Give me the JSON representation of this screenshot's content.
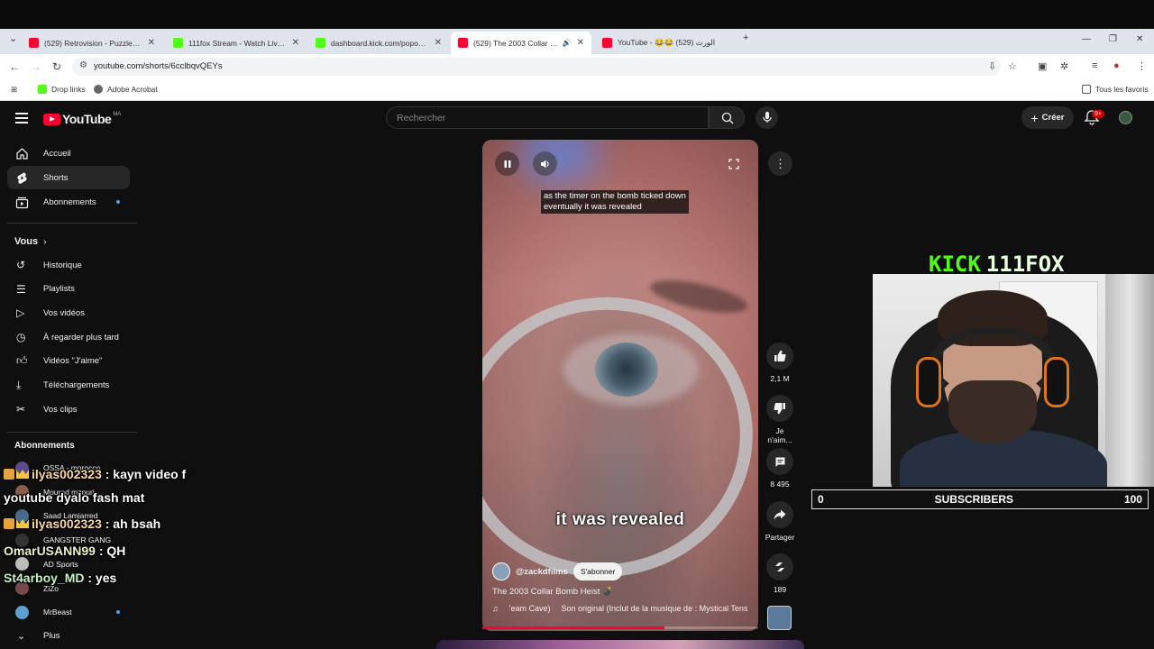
{
  "browser": {
    "tabs": [
      {
        "title": "(529) Retrovision - Puzzle (2024)",
        "favicon": "#ff0033",
        "active": false
      },
      {
        "title": "111fox Stream - Watch Live on Kick",
        "favicon": "#53fc18",
        "active": false
      },
      {
        "title": "dashboard.kick.com/popout/111fox",
        "favicon": "#53fc18",
        "active": false
      },
      {
        "title": "(529) The 2003 Collar Bomb Heist",
        "favicon": "#ff0033",
        "active": true
      },
      {
        "title": "YouTube - 😂😂 الورث (529)",
        "favicon": "#ff0033",
        "active": false
      }
    ],
    "url": "youtube.com/shorts/6cclbqvQEYs",
    "bookmarks": [
      {
        "label": "Drop links",
        "color": "#53fc18"
      },
      {
        "label": "Adobe Acrobat",
        "color": "#555"
      }
    ],
    "all_bookmarks": "Tous les favoris"
  },
  "youtube": {
    "logo": "YouTube",
    "country": "MA",
    "search_placeholder": "Rechercher",
    "create_label": "Créer",
    "notif_count": "9+"
  },
  "sidebar": {
    "main": [
      {
        "label": "Accueil",
        "icon": "home-icon"
      },
      {
        "label": "Shorts",
        "icon": "shorts-icon",
        "selected": true
      },
      {
        "label": "Abonnements",
        "icon": "subscriptions-icon",
        "dot": true
      }
    ],
    "you_header": "Vous",
    "you": [
      {
        "label": "Historique",
        "icon": "history-icon"
      },
      {
        "label": "Playlists",
        "icon": "playlists-icon"
      },
      {
        "label": "Vos vidéos",
        "icon": "your-videos-icon"
      },
      {
        "label": "À regarder plus tard",
        "icon": "watch-later-icon"
      },
      {
        "label": "Vidéos \"J'aime\"",
        "icon": "liked-icon"
      },
      {
        "label": "Téléchargements",
        "icon": "download-icon"
      },
      {
        "label": "Vos clips",
        "icon": "clips-icon"
      }
    ],
    "subs_header": "Abonnements",
    "subs": [
      {
        "label": "OSSA - morocco",
        "color": "#5d4a8c"
      },
      {
        "label": "Mourad mzouri",
        "color": "#8c5d4a"
      },
      {
        "label": "Saad Lamjarred",
        "color": "#4a6a8c"
      },
      {
        "label": "GANGSTER GANG",
        "color": "#333"
      },
      {
        "label": "AD Sports",
        "color": "#bbb"
      },
      {
        "label": "ZiZo",
        "color": "#7a4a4a"
      },
      {
        "label": "MrBeast",
        "color": "#5aa0d0",
        "dot": true
      }
    ],
    "more": "Plus"
  },
  "short": {
    "caption_top": "as the timer on the bomb ticked down\neventually it was revealed",
    "caption_bottom": "it was revealed",
    "channel": "@zackdfilms",
    "subscribe": "S'abonner",
    "title": "The 2003 Collar Bomb Heist 💣",
    "music_a": "'eam Cave)",
    "music_b": "Son original (Inclut de la musique de : Mystical Tens",
    "progress": 0.66,
    "likes": "2,1 M",
    "dislike": "Je n'aim...",
    "comments": "8 495",
    "share": "Partager",
    "remix": "189"
  },
  "overlay": {
    "kick_word": "KICK",
    "kick_user": "111FOX",
    "subs_left": "0",
    "subs_label": "SUBSCRIBERS",
    "subs_right": "100",
    "chat": [
      {
        "user": "ilyas002323",
        "msg": ": kayn video f",
        "cls": "u1",
        "badges": true
      },
      {
        "user": "",
        "msg": "youtube dyalo fash mat",
        "cls": "",
        "badges": false
      },
      {
        "user": "ilyas002323",
        "msg": ": ah bsah",
        "cls": "u1",
        "badges": true
      },
      {
        "user": "OmarUSANN99",
        "msg": ": QH",
        "cls": "u2",
        "badges": false
      },
      {
        "user": "St4arboy_MD",
        "msg": ": yes",
        "cls": "u3",
        "badges": false
      }
    ]
  }
}
